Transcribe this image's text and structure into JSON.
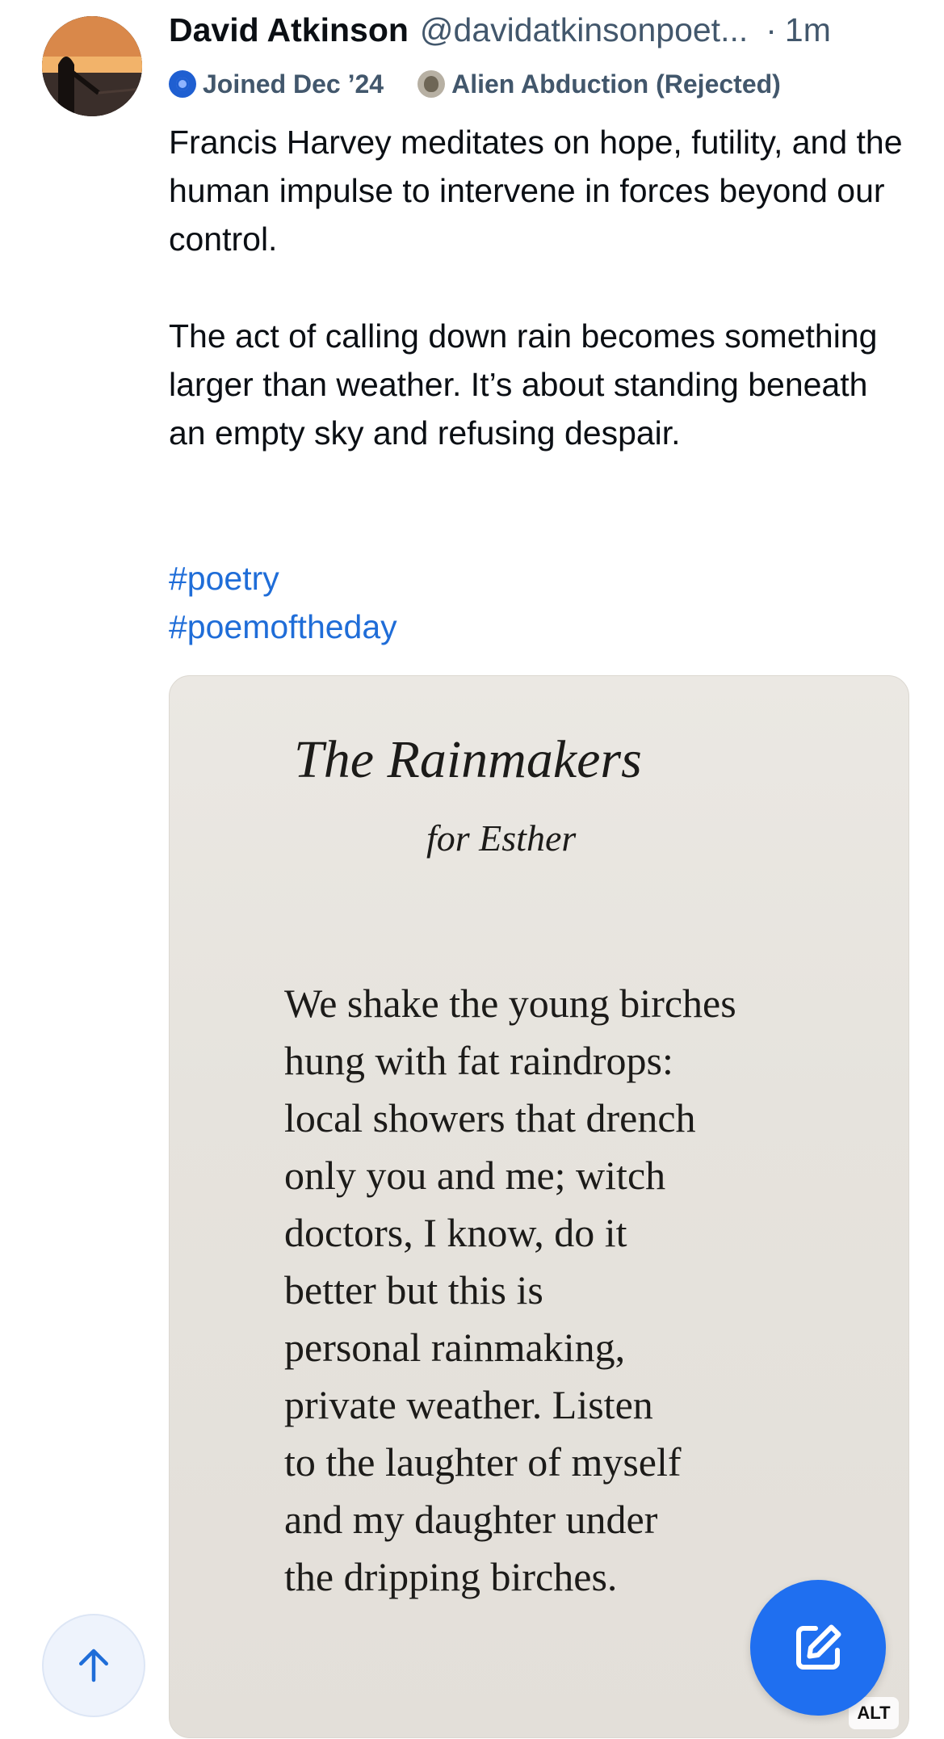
{
  "post": {
    "author": {
      "display_name": "David Atkinson",
      "handle": "@davidatkinsonpoet...",
      "separator": "·",
      "time": "1m",
      "avatar_icon": "avatar-photo"
    },
    "badges": {
      "joined": {
        "icon": "joined-badge-icon",
        "label": "Joined Dec ’24"
      },
      "custom": {
        "icon": "alien-badge-icon",
        "label": "Alien Abduction (Rejected)"
      }
    },
    "text": {
      "paragraph_1": "Francis Harvey meditates on hope, futility, and the human impulse to intervene in forces beyond our control.",
      "paragraph_2": "The act of calling down rain becomes something larger than weather.  It’s about standing beneath an empty sky and refusing despair."
    },
    "hashtags": [
      "#poetry",
      "#poemoftheday"
    ],
    "media": {
      "poem_title": "The Rainmakers",
      "poem_dedication": "for Esther",
      "poem_lines": [
        "We shake the young birches",
        "hung with fat raindrops:",
        "local showers that drench",
        "only you and me; witch",
        "doctors, I know, do it",
        "better but this is",
        "personal rainmaking,",
        "private weather. Listen",
        "to the laughter of myself",
        "and my daughter under",
        "the dripping birches."
      ],
      "alt_label": "ALT"
    }
  },
  "controls": {
    "scroll_top_icon": "arrow-up-icon",
    "compose_icon": "compose-icon"
  },
  "colors": {
    "link": "#1f6dd8",
    "muted": "#42576c",
    "fab": "#1f6ff0",
    "scroll_button_bg": "#eef3fc"
  }
}
